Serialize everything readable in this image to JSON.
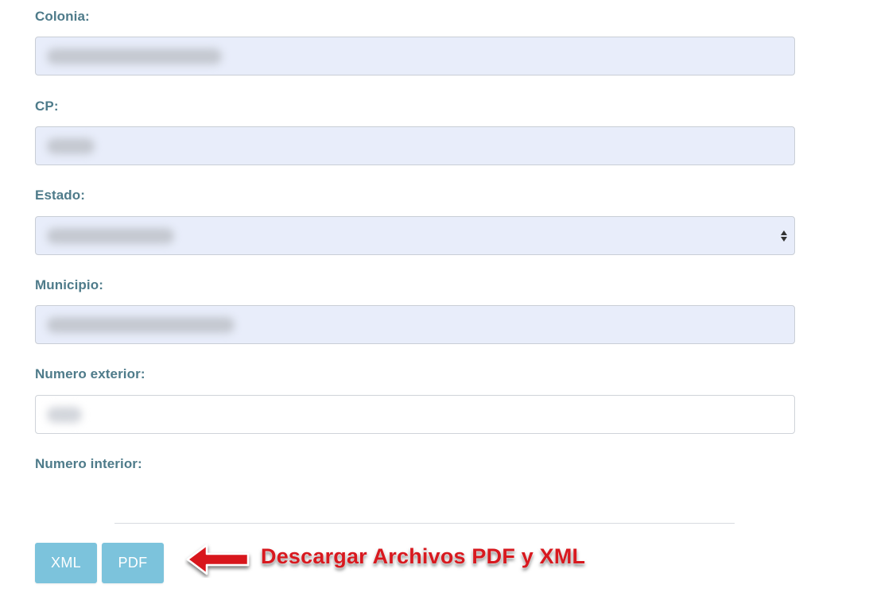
{
  "form": {
    "colonia": {
      "label": "Colonia:",
      "value": ""
    },
    "cp": {
      "label": "CP:",
      "value": ""
    },
    "estado": {
      "label": "Estado:",
      "value": ""
    },
    "municipio": {
      "label": "Municipio:",
      "value": ""
    },
    "numero_exterior": {
      "label": "Numero exterior:",
      "value": ""
    },
    "numero_interior": {
      "label": "Numero interior:",
      "value": ""
    }
  },
  "buttons": {
    "xml_label": "XML",
    "pdf_label": "PDF"
  },
  "annotation": {
    "text": "Descargar Archivos PDF y XML",
    "color": "#d8191f",
    "icon": "arrow-left-icon"
  },
  "colors": {
    "label": "#4e7b8a",
    "input_bg": "#e8edfa",
    "button_bg": "#7cc3dc"
  }
}
